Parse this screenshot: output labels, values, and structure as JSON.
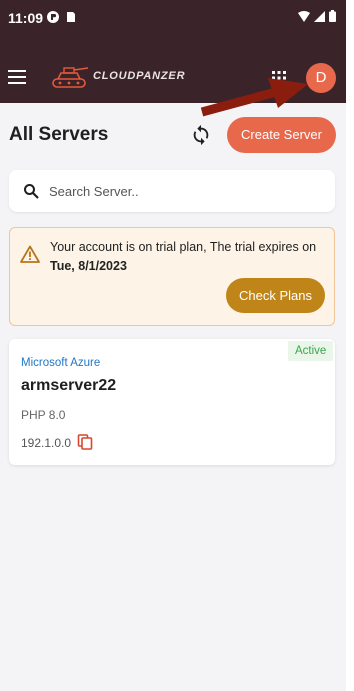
{
  "status_bar": {
    "time": "11:09"
  },
  "app_bar": {
    "logo_text": "CLOUDPANZER",
    "avatar_initial": "D",
    "avatar_color": "#e8684c"
  },
  "header": {
    "title": "All Servers",
    "create_label": "Create Server",
    "accent": "#e8684c"
  },
  "search": {
    "placeholder": "Search Server.."
  },
  "notice": {
    "text": "Your account is on trial plan, The trial expires on",
    "date": "Tue, 8/1/2023",
    "button_label": "Check Plans",
    "button_color": "#c08519"
  },
  "servers": [
    {
      "provider": "Microsoft Azure",
      "name": "armserver22",
      "php": "PHP 8.0",
      "ip": "192.1.0.0",
      "status": "Active"
    }
  ],
  "icons": [
    "menu-icon",
    "grid-icon",
    "sync-icon",
    "search-icon",
    "warning-icon",
    "copy-icon"
  ]
}
